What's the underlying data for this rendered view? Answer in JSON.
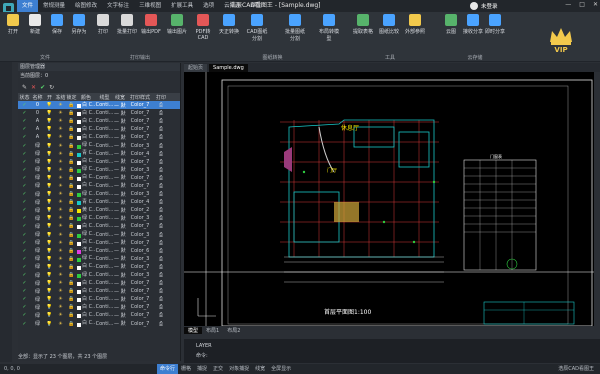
{
  "window": {
    "title": "浩辰CAD看图王 - [Sample.dwg]",
    "login": "未登录",
    "controls": [
      "—",
      "□",
      "✕"
    ]
  },
  "menu": [
    "文件",
    "常规测量",
    "绘图修改",
    "文字标注",
    "三维视图",
    "扩展工具",
    "选项",
    "云批注",
    "帮助"
  ],
  "ribbon": {
    "buttons": [
      {
        "label": "打开",
        "color": "#f2c94c"
      },
      {
        "label": "新建",
        "color": "#e9e9e9"
      },
      {
        "label": "保存",
        "color": "#4aa3ff"
      },
      {
        "label": "另存为",
        "color": "#4aa3ff"
      },
      {
        "label": "打印",
        "color": "#d9d9d9"
      },
      {
        "label": "批量打印",
        "color": "#d9d9d9"
      },
      {
        "label": "输出PDF",
        "color": "#e45757"
      },
      {
        "label": "输出图片",
        "color": "#57b36b"
      },
      {
        "label": "PDF转CAD",
        "color": "#e45757"
      },
      {
        "label": "天正转换",
        "color": "#4aa3ff"
      },
      {
        "label": "CAD图纸分割",
        "color": "#4aa3ff"
      },
      {
        "label": "批量图纸分割",
        "color": "#4aa3ff"
      },
      {
        "label": "布局转模型",
        "color": "#4aa3ff"
      },
      {
        "label": "提取表格",
        "color": "#57b36b"
      },
      {
        "label": "图纸比较",
        "color": "#4aa3ff"
      },
      {
        "label": "外部参照",
        "color": "#f2c94c"
      },
      {
        "label": "云图",
        "color": "#57b36b"
      },
      {
        "label": "接收分享",
        "color": "#4aa3ff"
      },
      {
        "label": "即时分享",
        "color": "#4aa3ff"
      }
    ],
    "groups": [
      "文件",
      "打印输出",
      "图纸转换",
      "工具",
      "云存储"
    ],
    "vip": "VIP"
  },
  "layer_panel": {
    "title": "图层管理器",
    "current": "当前图层：0",
    "tools": [
      "✎",
      "✕",
      "✔",
      "↻"
    ],
    "columns": [
      "状态",
      "名称",
      "开",
      "冻结",
      "锁定",
      "颜色",
      "线型",
      "线宽",
      "打印样式",
      "打印"
    ],
    "rows": [
      {
        "name": "0",
        "color": "白 C...",
        "lt": "Conti...",
        "lw": "— 默认",
        "ps": "Color_7",
        "sw": "#ffffff",
        "sel": true
      },
      {
        "name": "0",
        "color": "白 C...",
        "lt": "Conti...",
        "lw": "— 默认",
        "ps": "Color_7",
        "sw": "#ffffff"
      },
      {
        "name": "A",
        "color": "白 C...",
        "lt": "Conti...",
        "lw": "— 默认",
        "ps": "Color_7",
        "sw": "#ffffff"
      },
      {
        "name": "A",
        "color": "白 C...",
        "lt": "Conti...",
        "lw": "— 默认",
        "ps": "Color_7",
        "sw": "#ffffff"
      },
      {
        "name": "A",
        "color": "白 C...",
        "lt": "Conti...",
        "lw": "— 默认",
        "ps": "Color_7",
        "sw": "#ffffff"
      },
      {
        "name": "绿",
        "color": "绿 C...",
        "lt": "Conti...",
        "lw": "— 默认",
        "ps": "Color_3",
        "sw": "#2ecc40"
      },
      {
        "name": "绿",
        "color": "青 C...",
        "lt": "Conti...",
        "lw": "— 默认",
        "ps": "Color_4",
        "sw": "#19c9c9"
      },
      {
        "name": "绿",
        "color": "白 C...",
        "lt": "Conti...",
        "lw": "— 默认",
        "ps": "Color_7",
        "sw": "#ffffff"
      },
      {
        "name": "绿",
        "color": "绿 C...",
        "lt": "Conti...",
        "lw": "— 默认",
        "ps": "Color_3",
        "sw": "#2ecc40"
      },
      {
        "name": "绿",
        "color": "白 C...",
        "lt": "Conti...",
        "lw": "— 默认",
        "ps": "Color_7",
        "sw": "#ffffff"
      },
      {
        "name": "绿",
        "color": "白 C...",
        "lt": "Conti...",
        "lw": "— 默认",
        "ps": "Color_7",
        "sw": "#ffffff"
      },
      {
        "name": "绿",
        "color": "绿 C...",
        "lt": "Conti...",
        "lw": "— 默认",
        "ps": "Color_3",
        "sw": "#2ecc40"
      },
      {
        "name": "绿",
        "color": "青 C...",
        "lt": "Conti...",
        "lw": "— 默认",
        "ps": "Color_4",
        "sw": "#19c9c9"
      },
      {
        "name": "绿",
        "color": "黄 C...",
        "lt": "Conti...",
        "lw": "— 默认",
        "ps": "Color_2",
        "sw": "#f2e600"
      },
      {
        "name": "绿",
        "color": "绿 C...",
        "lt": "Conti...",
        "lw": "— 默认",
        "ps": "Color_3",
        "sw": "#2ecc40"
      },
      {
        "name": "绿",
        "color": "白 C...",
        "lt": "Conti...",
        "lw": "— 默认",
        "ps": "Color_7",
        "sw": "#ffffff"
      },
      {
        "name": "绿",
        "color": "绿 C...",
        "lt": "Conti...",
        "lw": "— 默认",
        "ps": "Color_3",
        "sw": "#2ecc40"
      },
      {
        "name": "绿",
        "color": "白 C...",
        "lt": "Conti...",
        "lw": "— 默认",
        "ps": "Color_7",
        "sw": "#ffffff"
      },
      {
        "name": "绿",
        "color": "洋 C...",
        "lt": "Conti...",
        "lw": "— 默认",
        "ps": "Color_6",
        "sw": "#e23de2"
      },
      {
        "name": "绿",
        "color": "绿 C...",
        "lt": "Conti...",
        "lw": "— 默认",
        "ps": "Color_3",
        "sw": "#2ecc40"
      },
      {
        "name": "绿",
        "color": "白 C...",
        "lt": "Conti...",
        "lw": "— 默认",
        "ps": "Color_7",
        "sw": "#ffffff"
      },
      {
        "name": "绿",
        "color": "绿 C...",
        "lt": "Conti...",
        "lw": "— 默认",
        "ps": "Color_3",
        "sw": "#2ecc40"
      },
      {
        "name": "绿",
        "color": "白 C...",
        "lt": "Conti...",
        "lw": "— 默认",
        "ps": "Color_7",
        "sw": "#ffffff"
      },
      {
        "name": "绿",
        "color": "白 C...",
        "lt": "Conti...",
        "lw": "— 默认",
        "ps": "Color_7",
        "sw": "#ffffff"
      },
      {
        "name": "绿",
        "color": "白 C...",
        "lt": "Conti...",
        "lw": "— 默认",
        "ps": "Color_7",
        "sw": "#ffffff"
      },
      {
        "name": "绿",
        "color": "白 C...",
        "lt": "Conti...",
        "lw": "— 默认",
        "ps": "Color_7",
        "sw": "#ffffff"
      },
      {
        "name": "绿",
        "color": "白 C...",
        "lt": "Conti...",
        "lw": "— 默认",
        "ps": "Color_7",
        "sw": "#ffffff"
      },
      {
        "name": "绿",
        "color": "白 C...",
        "lt": "Conti...",
        "lw": "— 默认",
        "ps": "Color_7",
        "sw": "#ffffff"
      }
    ],
    "status": "全部：显示了 23 个图层，共 23 个图层"
  },
  "doc_tabs": [
    "起始页",
    "Sample.dwg"
  ],
  "drawing": {
    "plan_title": "首层平面图1:100",
    "room_label": "休息厅",
    "room_label2": "门厅",
    "table_title": "门窗表"
  },
  "layout_tabs": [
    "模型",
    "布局1",
    "布局2"
  ],
  "command": {
    "history": "LAYER",
    "prompt": "命令:"
  },
  "statusbar": {
    "coord": "0, 0, 0",
    "buttons": [
      "命令行",
      "栅格",
      "捕捉",
      "正交",
      "对象捕捉",
      "线宽",
      "全屏显示"
    ],
    "brand": "浩辰CAD看图王"
  }
}
